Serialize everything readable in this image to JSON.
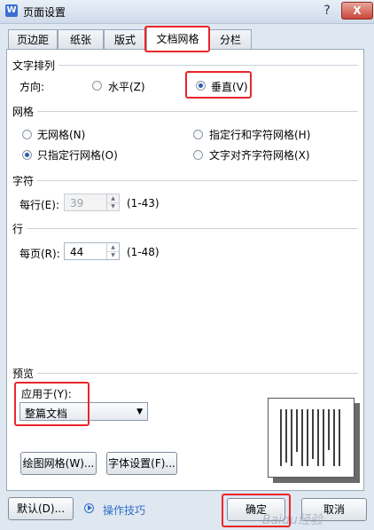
{
  "window": {
    "title": "页面设置",
    "app_icon": "W",
    "help": "?",
    "close": "X"
  },
  "tabs": [
    "页边距",
    "纸张",
    "版式",
    "文档网格",
    "分栏"
  ],
  "text_direction": {
    "group_label": "文字排列",
    "label": "方向:",
    "options": [
      "水平(Z)",
      "垂直(V)"
    ],
    "selected": "垂直(V)"
  },
  "grid": {
    "group_label": "网格",
    "options": [
      "无网格(N)",
      "指定行和字符网格(H)",
      "只指定行网格(O)",
      "文字对齐字符网格(X)"
    ],
    "selected": "只指定行网格(O)"
  },
  "chars": {
    "group_label": "字符",
    "label": "每行(E):",
    "value": "39",
    "range": "(1-43)"
  },
  "lines": {
    "group_label": "行",
    "label": "每页(R):",
    "value": "44",
    "range": "(1-48)"
  },
  "preview": {
    "group_label": "预览",
    "apply_label": "应用于(Y):",
    "apply_value": "整篇文档"
  },
  "buttons": {
    "draw_grid": "绘图网格(W)...",
    "font_settings": "字体设置(F)...",
    "default": "默认(D)...",
    "tips": "操作技巧",
    "ok": "确定",
    "cancel": "取消"
  },
  "watermark": "Baidu经验",
  "colors": {
    "highlight": "#e8262a",
    "accent": "#2f6fc7"
  },
  "icons": [
    "app-icon",
    "help-icon",
    "close-icon",
    "tips-play-icon",
    "spin-up-icon",
    "spin-down-icon",
    "dropdown-arrow-icon"
  ]
}
